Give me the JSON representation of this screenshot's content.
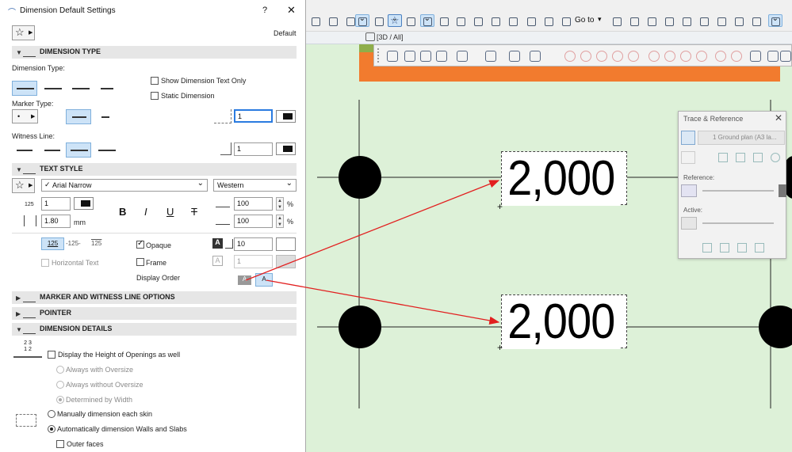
{
  "dialog": {
    "title": "Dimension Default Settings",
    "help": "?",
    "close": "✕",
    "preset": "Default",
    "sections": {
      "dimension_type": "DIMENSION TYPE",
      "text_style": "TEXT STYLE",
      "marker_options": "MARKER AND WITNESS LINE OPTIONS",
      "pointer": "POINTER",
      "dimension_details": "DIMENSION DETAILS"
    },
    "dimension_type_label": "Dimension Type:",
    "marker_type_label": "Marker Type:",
    "witness_line_label": "Witness Line:",
    "show_text_only": "Show Dimension Text Only",
    "static_dimension": "Static Dimension",
    "marker_pen": "1",
    "witness_pen": "1",
    "font": "Arial Narrow",
    "script": "Western",
    "text_size": "1",
    "text_size_unit_prefix": "125",
    "height": "1.80",
    "height_unit": "mm",
    "width_pct": "100",
    "spacing_pct": "100",
    "pct": "%",
    "bold": "B",
    "italic": "I",
    "underline": "U",
    "strike": "T",
    "align_samples": [
      "125",
      "-125-",
      "125"
    ],
    "horizontal_text": "Horizontal Text",
    "opaque": "Opaque",
    "frame": "Frame",
    "display_order": "Display Order",
    "bg_pen": "10",
    "frame_pen": "1",
    "details_ic": "2 3\n1 2",
    "display_height": "Display the Height of Openings as well",
    "always_with": "Always with Oversize",
    "always_without": "Always without Oversize",
    "determined_width": "Determined by Width",
    "manual_skin": "Manually dimension each skin",
    "auto_walls": "Automatically dimension Walls and Slabs",
    "outer_faces": "Outer faces"
  },
  "toolbar": {
    "goto": "Go to"
  },
  "tab": {
    "label": "[3D / All]"
  },
  "canvas": {
    "dim1": "2,000",
    "dim2": "2,000"
  },
  "trace": {
    "title": "Trace & Reference",
    "plan": "1 Ground plan (A3 la...",
    "reference": "Reference:",
    "active": "Active:"
  },
  "colors": {
    "accent": "#2a7be0",
    "selected_bg": "#cde3f7",
    "canvas": "#ddf1d8",
    "orange": "#f27b2e",
    "arrow": "#e21f1f"
  }
}
